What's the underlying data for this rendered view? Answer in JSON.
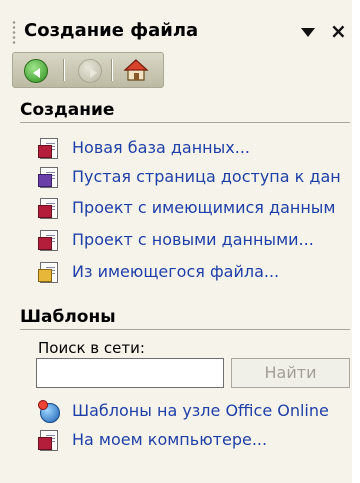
{
  "task_pane": {
    "title": "Создание файла",
    "toolbar": {
      "back": "back-icon",
      "forward": "forward-icon",
      "home": "home-icon"
    }
  },
  "create_section": {
    "heading": "Создание",
    "items": [
      {
        "label": "Новая база данных...",
        "icon": "database-file-icon"
      },
      {
        "label": "Пустая страница доступа к дан",
        "icon": "access-page-icon"
      },
      {
        "label": "Проект с имеющимися данным",
        "icon": "project-existing-data-icon"
      },
      {
        "label": "Проект с новыми данными...",
        "icon": "project-new-data-icon"
      },
      {
        "label": "Из имеющегося файла...",
        "icon": "existing-file-icon"
      }
    ]
  },
  "templates_section": {
    "heading": "Шаблоны",
    "search_label": "Поиск в сети:",
    "search_value": "",
    "search_button": "Найти",
    "items": [
      {
        "label": "Шаблоны на узле Office Online",
        "icon": "office-online-globe-icon"
      },
      {
        "label": "На моем компьютере...",
        "icon": "my-computer-templates-icon"
      }
    ]
  },
  "colors": {
    "link": "#1f3fa8",
    "pane_bg": "#f6f4ea"
  }
}
